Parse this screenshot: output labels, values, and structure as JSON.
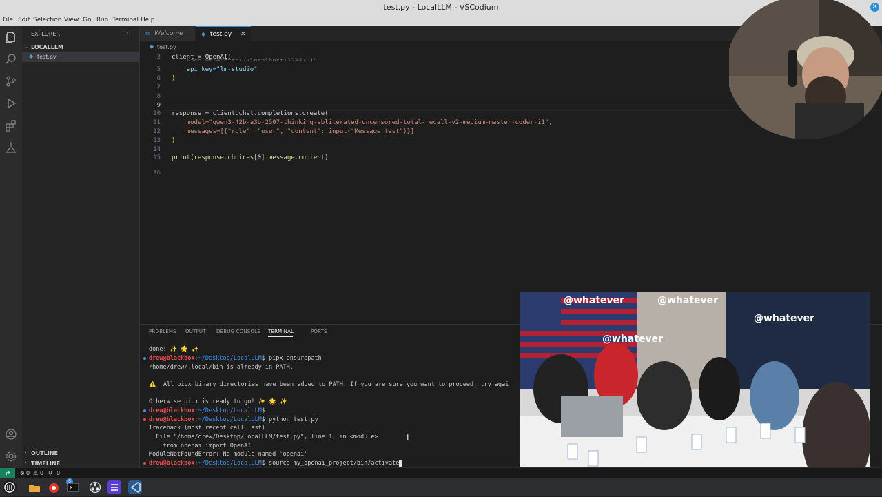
{
  "window": {
    "title": "test.py - LocalLLM - VSCodium"
  },
  "menu": [
    "File",
    "Edit",
    "Selection",
    "View",
    "Go",
    "Run",
    "Terminal",
    "Help"
  ],
  "sidebar": {
    "header": "EXPLORER",
    "folder": "LOCALLLM",
    "file": "test.py",
    "outline": "OUTLINE",
    "timeline": "TIMELINE"
  },
  "tabs": [
    {
      "label": "Welcome",
      "active": false
    },
    {
      "label": "test.py",
      "active": true
    }
  ],
  "breadcrumb": "test.py",
  "editor": {
    "lines": [
      {
        "num": "3",
        "text": "client = OpenAI("
      },
      {
        "num": "5",
        "text": "    api_key=\"lm-studio\""
      },
      {
        "num": "6",
        "text": ")"
      },
      {
        "num": "7",
        "text": ""
      },
      {
        "num": "8",
        "text": ""
      },
      {
        "num": "9",
        "text": ""
      },
      {
        "num": "10",
        "text": "response = client.chat.completions.create("
      },
      {
        "num": "11",
        "text": "    model=\"qwen3-42b-a3b-2507-thinking-abliterated-uncensored-total-recall-v2-medium-master-coder-i1\","
      },
      {
        "num": "12",
        "text": "    messages=[{\"role\": \"user\", \"content\": input(\"Message_test\")}]"
      },
      {
        "num": "13",
        "text": ")"
      },
      {
        "num": "14",
        "text": ""
      },
      {
        "num": "15",
        "text": "print(response.choices[0].message.content)"
      },
      {
        "num": "16",
        "text": ""
      }
    ]
  },
  "panel": {
    "tabs": [
      "PROBLEMS",
      "OUTPUT",
      "DEBUG CONSOLE",
      "TERMINAL",
      "PORTS"
    ],
    "active_tab": "TERMINAL",
    "terminal": [
      {
        "kind": "out",
        "text": "done! ✨ 🌟 ✨"
      },
      {
        "kind": "cmd",
        "user": "drew@blackbox",
        "path": ":~/Desktop/LocalLLM",
        "cmd": "$ pipx ensurepath",
        "dot": "blue"
      },
      {
        "kind": "out",
        "text": "/home/drew/.local/bin is already in PATH."
      },
      {
        "kind": "out",
        "text": ""
      },
      {
        "kind": "out",
        "text": "⚠️  All pipx binary directories have been added to PATH. If you are sure you want to proceed, try agai"
      },
      {
        "kind": "out",
        "text": ""
      },
      {
        "kind": "out",
        "text": "Otherwise pipx is ready to go! ✨ 🌟 ✨"
      },
      {
        "kind": "cmd",
        "user": "drew@blackbox",
        "path": ":~/Desktop/LocalLLM",
        "cmd": "$",
        "dot": "blue"
      },
      {
        "kind": "cmd",
        "user": "drew@blackbox",
        "path": ":~/Desktop/LocalLLM",
        "cmd": "$ python test.py",
        "dot": "red"
      },
      {
        "kind": "out",
        "text": "Traceback (most recent call last):"
      },
      {
        "kind": "out",
        "text": "  File \"/home/drew/Desktop/LocalLLM/test.py\", line 1, in <module>"
      },
      {
        "kind": "out",
        "text": "    from openai import OpenAI"
      },
      {
        "kind": "out",
        "text": "ModuleNotFoundError: No module named 'openai'"
      },
      {
        "kind": "cmd",
        "user": "drew@blackbox",
        "path": ":~/Desktop/LocalLLM",
        "cmd": "$ source my_openai_project/bin/activate",
        "dot": "red"
      }
    ]
  },
  "statusbar": {
    "errors": "0",
    "warnings": "0",
    "ports": "0"
  },
  "taskbar": {
    "badge": "5"
  },
  "overlays": {
    "studio_watermark": "@whatever"
  }
}
